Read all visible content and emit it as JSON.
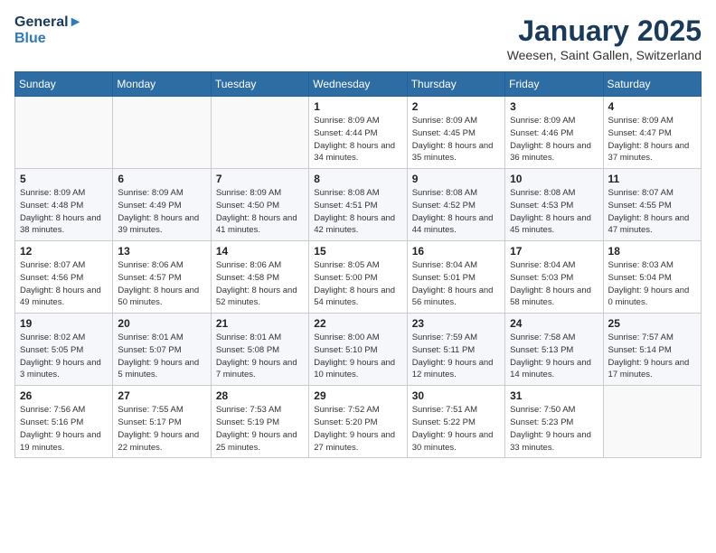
{
  "header": {
    "logo_line1": "General",
    "logo_line2": "Blue",
    "month": "January 2025",
    "location": "Weesen, Saint Gallen, Switzerland"
  },
  "weekdays": [
    "Sunday",
    "Monday",
    "Tuesday",
    "Wednesday",
    "Thursday",
    "Friday",
    "Saturday"
  ],
  "weeks": [
    [
      {
        "day": "",
        "sunrise": "",
        "sunset": "",
        "daylight": ""
      },
      {
        "day": "",
        "sunrise": "",
        "sunset": "",
        "daylight": ""
      },
      {
        "day": "",
        "sunrise": "",
        "sunset": "",
        "daylight": ""
      },
      {
        "day": "1",
        "sunrise": "Sunrise: 8:09 AM",
        "sunset": "Sunset: 4:44 PM",
        "daylight": "Daylight: 8 hours and 34 minutes."
      },
      {
        "day": "2",
        "sunrise": "Sunrise: 8:09 AM",
        "sunset": "Sunset: 4:45 PM",
        "daylight": "Daylight: 8 hours and 35 minutes."
      },
      {
        "day": "3",
        "sunrise": "Sunrise: 8:09 AM",
        "sunset": "Sunset: 4:46 PM",
        "daylight": "Daylight: 8 hours and 36 minutes."
      },
      {
        "day": "4",
        "sunrise": "Sunrise: 8:09 AM",
        "sunset": "Sunset: 4:47 PM",
        "daylight": "Daylight: 8 hours and 37 minutes."
      }
    ],
    [
      {
        "day": "5",
        "sunrise": "Sunrise: 8:09 AM",
        "sunset": "Sunset: 4:48 PM",
        "daylight": "Daylight: 8 hours and 38 minutes."
      },
      {
        "day": "6",
        "sunrise": "Sunrise: 8:09 AM",
        "sunset": "Sunset: 4:49 PM",
        "daylight": "Daylight: 8 hours and 39 minutes."
      },
      {
        "day": "7",
        "sunrise": "Sunrise: 8:09 AM",
        "sunset": "Sunset: 4:50 PM",
        "daylight": "Daylight: 8 hours and 41 minutes."
      },
      {
        "day": "8",
        "sunrise": "Sunrise: 8:08 AM",
        "sunset": "Sunset: 4:51 PM",
        "daylight": "Daylight: 8 hours and 42 minutes."
      },
      {
        "day": "9",
        "sunrise": "Sunrise: 8:08 AM",
        "sunset": "Sunset: 4:52 PM",
        "daylight": "Daylight: 8 hours and 44 minutes."
      },
      {
        "day": "10",
        "sunrise": "Sunrise: 8:08 AM",
        "sunset": "Sunset: 4:53 PM",
        "daylight": "Daylight: 8 hours and 45 minutes."
      },
      {
        "day": "11",
        "sunrise": "Sunrise: 8:07 AM",
        "sunset": "Sunset: 4:55 PM",
        "daylight": "Daylight: 8 hours and 47 minutes."
      }
    ],
    [
      {
        "day": "12",
        "sunrise": "Sunrise: 8:07 AM",
        "sunset": "Sunset: 4:56 PM",
        "daylight": "Daylight: 8 hours and 49 minutes."
      },
      {
        "day": "13",
        "sunrise": "Sunrise: 8:06 AM",
        "sunset": "Sunset: 4:57 PM",
        "daylight": "Daylight: 8 hours and 50 minutes."
      },
      {
        "day": "14",
        "sunrise": "Sunrise: 8:06 AM",
        "sunset": "Sunset: 4:58 PM",
        "daylight": "Daylight: 8 hours and 52 minutes."
      },
      {
        "day": "15",
        "sunrise": "Sunrise: 8:05 AM",
        "sunset": "Sunset: 5:00 PM",
        "daylight": "Daylight: 8 hours and 54 minutes."
      },
      {
        "day": "16",
        "sunrise": "Sunrise: 8:04 AM",
        "sunset": "Sunset: 5:01 PM",
        "daylight": "Daylight: 8 hours and 56 minutes."
      },
      {
        "day": "17",
        "sunrise": "Sunrise: 8:04 AM",
        "sunset": "Sunset: 5:03 PM",
        "daylight": "Daylight: 8 hours and 58 minutes."
      },
      {
        "day": "18",
        "sunrise": "Sunrise: 8:03 AM",
        "sunset": "Sunset: 5:04 PM",
        "daylight": "Daylight: 9 hours and 0 minutes."
      }
    ],
    [
      {
        "day": "19",
        "sunrise": "Sunrise: 8:02 AM",
        "sunset": "Sunset: 5:05 PM",
        "daylight": "Daylight: 9 hours and 3 minutes."
      },
      {
        "day": "20",
        "sunrise": "Sunrise: 8:01 AM",
        "sunset": "Sunset: 5:07 PM",
        "daylight": "Daylight: 9 hours and 5 minutes."
      },
      {
        "day": "21",
        "sunrise": "Sunrise: 8:01 AM",
        "sunset": "Sunset: 5:08 PM",
        "daylight": "Daylight: 9 hours and 7 minutes."
      },
      {
        "day": "22",
        "sunrise": "Sunrise: 8:00 AM",
        "sunset": "Sunset: 5:10 PM",
        "daylight": "Daylight: 9 hours and 10 minutes."
      },
      {
        "day": "23",
        "sunrise": "Sunrise: 7:59 AM",
        "sunset": "Sunset: 5:11 PM",
        "daylight": "Daylight: 9 hours and 12 minutes."
      },
      {
        "day": "24",
        "sunrise": "Sunrise: 7:58 AM",
        "sunset": "Sunset: 5:13 PM",
        "daylight": "Daylight: 9 hours and 14 minutes."
      },
      {
        "day": "25",
        "sunrise": "Sunrise: 7:57 AM",
        "sunset": "Sunset: 5:14 PM",
        "daylight": "Daylight: 9 hours and 17 minutes."
      }
    ],
    [
      {
        "day": "26",
        "sunrise": "Sunrise: 7:56 AM",
        "sunset": "Sunset: 5:16 PM",
        "daylight": "Daylight: 9 hours and 19 minutes."
      },
      {
        "day": "27",
        "sunrise": "Sunrise: 7:55 AM",
        "sunset": "Sunset: 5:17 PM",
        "daylight": "Daylight: 9 hours and 22 minutes."
      },
      {
        "day": "28",
        "sunrise": "Sunrise: 7:53 AM",
        "sunset": "Sunset: 5:19 PM",
        "daylight": "Daylight: 9 hours and 25 minutes."
      },
      {
        "day": "29",
        "sunrise": "Sunrise: 7:52 AM",
        "sunset": "Sunset: 5:20 PM",
        "daylight": "Daylight: 9 hours and 27 minutes."
      },
      {
        "day": "30",
        "sunrise": "Sunrise: 7:51 AM",
        "sunset": "Sunset: 5:22 PM",
        "daylight": "Daylight: 9 hours and 30 minutes."
      },
      {
        "day": "31",
        "sunrise": "Sunrise: 7:50 AM",
        "sunset": "Sunset: 5:23 PM",
        "daylight": "Daylight: 9 hours and 33 minutes."
      },
      {
        "day": "",
        "sunrise": "",
        "sunset": "",
        "daylight": ""
      }
    ]
  ]
}
